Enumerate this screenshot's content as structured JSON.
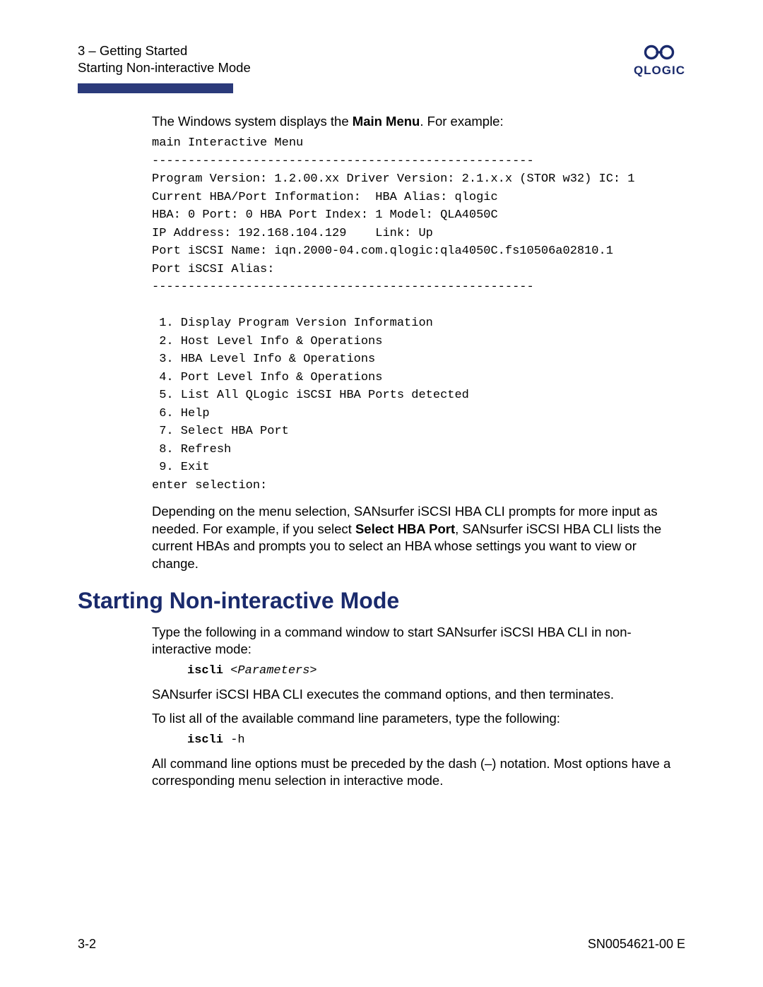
{
  "header": {
    "chapter": "3 – Getting Started",
    "section": "Starting Non-interactive Mode",
    "brand": "QLOGIC"
  },
  "intro_prefix": "The Windows system displays the ",
  "intro_bold": "Main Menu",
  "intro_suffix": ". For example:",
  "code": "main Interactive Menu\n-----------------------------------------------------\nProgram Version: 1.2.00.xx Driver Version: 2.1.x.x (STOR w32) IC: 1\nCurrent HBA/Port Information:  HBA Alias: qlogic\nHBA: 0 Port: 0 HBA Port Index: 1 Model: QLA4050C\nIP Address: 192.168.104.129    Link: Up\nPort iSCSI Name: iqn.2000-04.com.qlogic:qla4050C.fs10506a02810.1\nPort iSCSI Alias:\n-----------------------------------------------------\n\n 1. Display Program Version Information\n 2. Host Level Info & Operations\n 3. HBA Level Info & Operations\n 4. Port Level Info & Operations\n 5. List All QLogic iSCSI HBA Ports detected\n 6. Help\n 7. Select HBA Port\n 8. Refresh\n 9. Exit\nenter selection:",
  "after_prefix": "Depending on the menu selection, SANsurfer iSCSI HBA CLI prompts for more input as needed. For example, if you select ",
  "after_bold": "Select HBA Port",
  "after_suffix": ", SANsurfer iSCSI HBA CLI lists the current HBAs and prompts you to select an HBA whose settings you want to view or change.",
  "heading": "Starting Non-interactive Mode",
  "p1": "Type the following in a command window to start SANsurfer iSCSI HBA CLI in non-interactive mode:",
  "cmd1_bold": "iscli ",
  "cmd1_ital": "<Parameters>",
  "p2": "SANsurfer iSCSI HBA CLI executes the command options, and then terminates.",
  "p3": "To list all of the available command line parameters, type the following:",
  "cmd2_bold": "iscli ",
  "cmd2_rest": "-h",
  "p4": "All command line options must be preceded by the dash (–) notation. Most options have a corresponding menu selection in interactive mode.",
  "footer": {
    "left": "3-2",
    "right": "SN0054621-00  E"
  }
}
